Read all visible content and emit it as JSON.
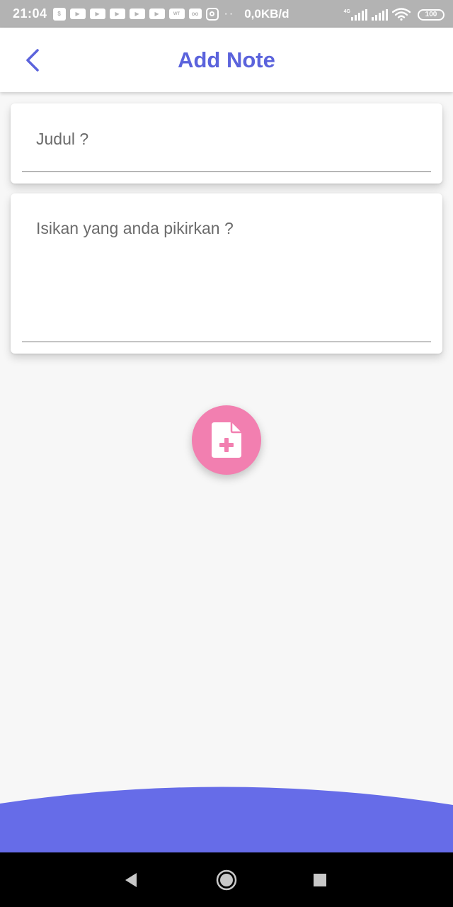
{
  "status_bar": {
    "time": "21:04",
    "network_speed": "0,0KB/d",
    "network_type": "4G",
    "battery": "100",
    "notification_icons": [
      "shopping-bag-icon",
      "youtube-icon",
      "youtube-icon",
      "youtube-icon",
      "youtube-icon",
      "youtube-icon",
      "webtoon-icon",
      "gallery-icon",
      "instagram-icon"
    ],
    "more_indicator": "··",
    "color": "#b3b3b3"
  },
  "app_bar": {
    "title": "Add Note",
    "back_icon": "chevron-left-icon",
    "accent_color": "#5b63dc"
  },
  "form": {
    "title_placeholder": "Judul ?",
    "title_value": "",
    "body_placeholder": "Isikan yang anda pikirkan ?",
    "body_value": ""
  },
  "add_button": {
    "icon": "file-add-icon",
    "color": "#f27fb0"
  },
  "bottom_wave": {
    "color": "#666ce8"
  },
  "nav_bar": {
    "back_icon": "triangle-back-icon",
    "home_icon": "circle-home-icon",
    "recents_icon": "square-recents-icon"
  }
}
